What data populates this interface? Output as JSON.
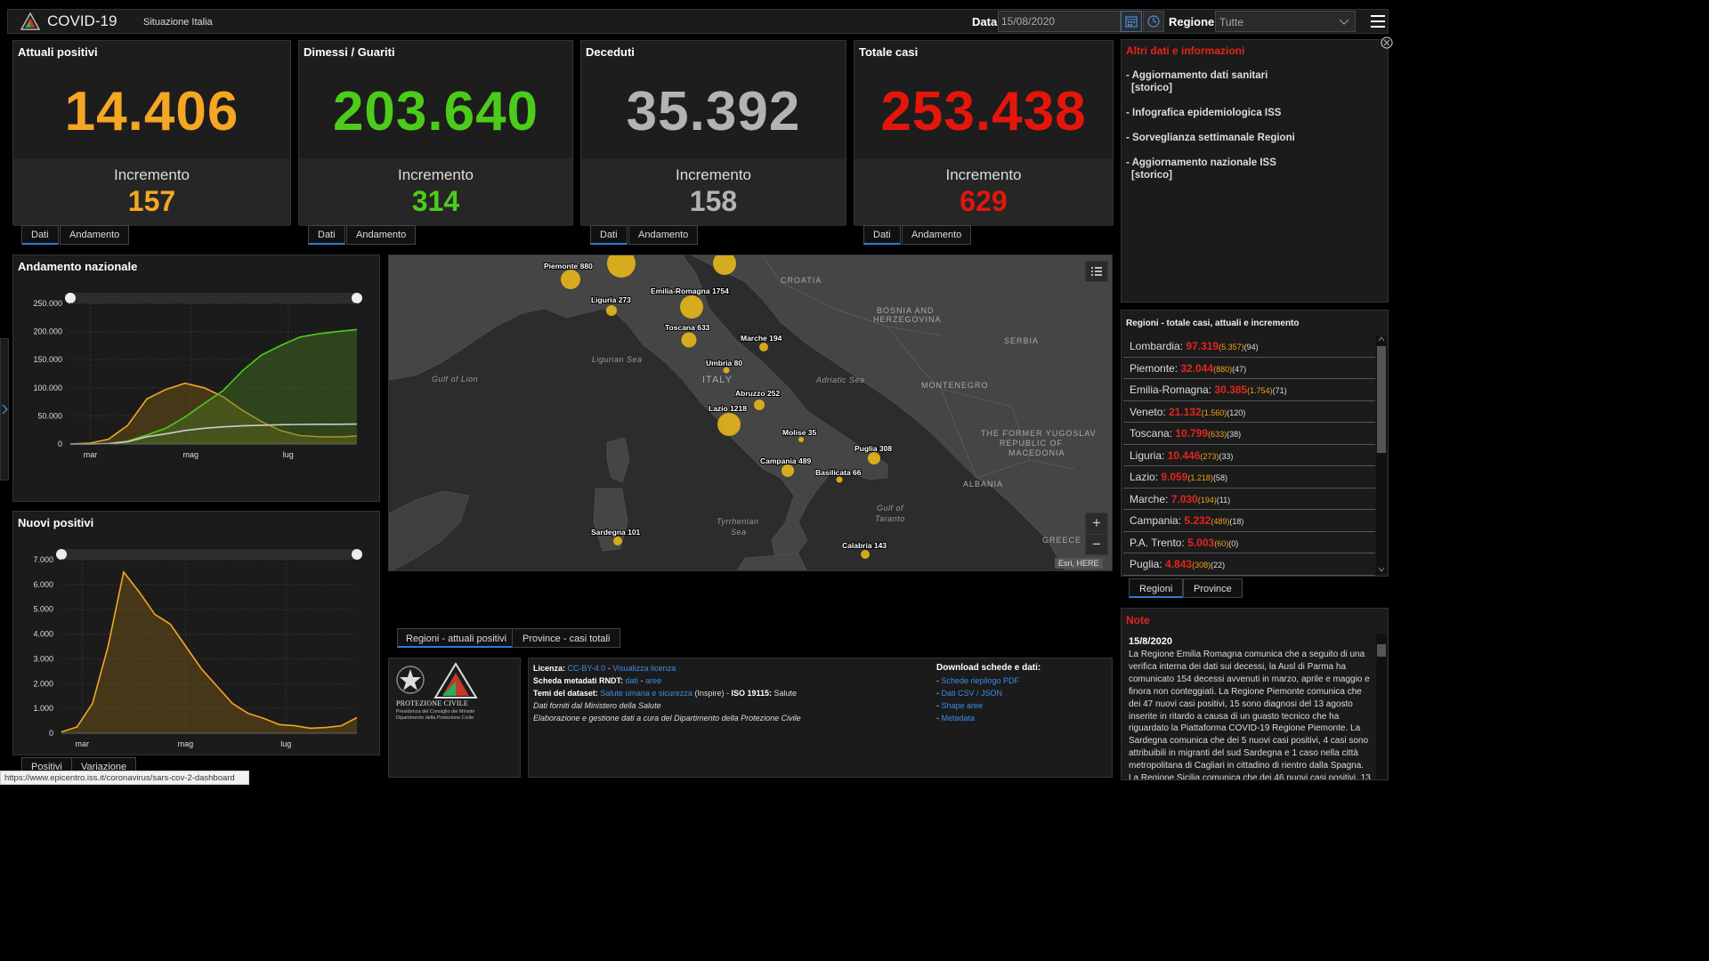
{
  "header": {
    "title": "COVID-19",
    "subtitle": "Situazione Italia",
    "date_label": "Data",
    "date_value": "15/08/2020",
    "region_label": "Regione",
    "region_value": "Tutte"
  },
  "stats": [
    {
      "title": "Attuali positivi",
      "value": "14.406",
      "inc_label": "Incremento",
      "inc": "157",
      "color": "#f5a623"
    },
    {
      "title": "Dimessi / Guariti",
      "value": "203.640",
      "inc_label": "Incremento",
      "inc": "314",
      "color": "#4ccc1a"
    },
    {
      "title": "Deceduti",
      "value": "35.392",
      "inc_label": "Incremento",
      "inc": "158",
      "color": "#b3b3b3"
    },
    {
      "title": "Totale casi",
      "value": "253.438",
      "inc_label": "Incremento",
      "inc": "629",
      "color": "#e4160c"
    }
  ],
  "stat_tabs": {
    "dati": "Dati",
    "andamento": "Andamento"
  },
  "info": {
    "title": "Altri dati e informazioni",
    "items": [
      "- Aggiornamento dati sanitari",
      "[storico]",
      "- Infografica epidemiologica ISS",
      "- Sorveglianza settimanale Regioni",
      "- Aggiornamento nazionale ISS",
      "[storico]"
    ]
  },
  "regions": {
    "title": "Regioni - totale casi, attuali e incremento",
    "rows": [
      {
        "name": "Lombardia:",
        "total": "97.319",
        "active": "(5.357)",
        "inc": "(94)"
      },
      {
        "name": "Piemonte:",
        "total": "32.044",
        "active": "(880)",
        "inc": "(47)"
      },
      {
        "name": "Emilia-Romagna:",
        "total": "30.385",
        "active": "(1.754)",
        "inc": "(71)"
      },
      {
        "name": "Veneto:",
        "total": "21.132",
        "active": "(1.560)",
        "inc": "(120)"
      },
      {
        "name": "Toscana:",
        "total": "10.799",
        "active": "(633)",
        "inc": "(38)"
      },
      {
        "name": "Liguria:",
        "total": "10.446",
        "active": "(273)",
        "inc": "(33)"
      },
      {
        "name": "Lazio:",
        "total": "9.059",
        "active": "(1.218)",
        "inc": "(58)"
      },
      {
        "name": "Marche:",
        "total": "7.030",
        "active": "(194)",
        "inc": "(11)"
      },
      {
        "name": "Campania:",
        "total": "5.232",
        "active": "(489)",
        "inc": "(18)"
      },
      {
        "name": "P.A. Trento:",
        "total": "5.003",
        "active": "(60)",
        "inc": "(0)"
      },
      {
        "name": "Puglia:",
        "total": "4.843",
        "active": "(308)",
        "inc": "(22)"
      }
    ],
    "tab_regioni": "Regioni",
    "tab_province": "Province"
  },
  "note": {
    "title": "Note",
    "date": "15/8/2020",
    "text": "La Regione Emilia Romagna comunica che a seguito di una verifica interna dei dati sui decessi, la Ausl di Parma ha comunicato 154 decessi avvenuti in marzo, aprile e maggio e finora non conteggiati. La Regione Piemonte comunica che dei 47 nuovi casi positivi, 15 sono diagnosi del 13 agosto inserite in ritardo a causa di un guasto tecnico che ha riguardato la Piattaforma COVID-19 Regione Piemonte. La Sardegna comunica che dei 5 nuovi casi positivi, 4 casi sono attribuibili in migranti del sud Sardegna e 1 caso nella città metropolitana di Cagliari in cittadino di rientro dalla Spagna. La Regione Sicilia comunica che dei 46 nuovi casi positivi, 13"
  },
  "andamento": {
    "title": "Andamento nazionale",
    "yticks": [
      "250.000",
      "200.000",
      "150.000",
      "100.000",
      "50.000",
      "0"
    ],
    "xticks": [
      "mar",
      "mag",
      "lug"
    ]
  },
  "nuovi": {
    "title": "Nuovi positivi",
    "yticks": [
      "7.000",
      "6.000",
      "5.000",
      "4.000",
      "3.000",
      "2.000",
      "1.000",
      "0"
    ],
    "xticks": [
      "mar",
      "mag",
      "lug"
    ],
    "tab_positivi": "Positivi",
    "tab_variazione": "Variazione"
  },
  "chart_data": [
    {
      "type": "area",
      "title": "Andamento nazionale",
      "x": [
        "feb-24",
        "mar-01",
        "mar-10",
        "mar-20",
        "apr-01",
        "apr-10",
        "apr-20",
        "mag-01",
        "mag-10",
        "mag-20",
        "giu-01",
        "giu-15",
        "lug-01",
        "lug-15",
        "ago-01",
        "ago-15"
      ],
      "series": [
        {
          "values": [
            200,
            1500,
            8500,
            33000,
            80000,
            97000,
            108000,
            100000,
            84000,
            60000,
            40000,
            24000,
            15000,
            13000,
            12500,
            14400
          ]
        },
        {
          "values": [
            0,
            50,
            700,
            5000,
            16000,
            28000,
            48000,
            72000,
            95000,
            130000,
            158000,
            175000,
            190000,
            196000,
            200000,
            203640
          ]
        },
        {
          "values": [
            10,
            30,
            630,
            4000,
            13000,
            18000,
            24000,
            28000,
            30500,
            32300,
            33400,
            34300,
            34800,
            35100,
            35200,
            35392
          ]
        }
      ],
      "ylim": [
        0,
        250000
      ]
    },
    {
      "type": "area",
      "title": "Nuovi positivi",
      "x": [
        "feb-24",
        "mar-01",
        "mar-08",
        "mar-15",
        "mar-21",
        "mar-28",
        "apr-04",
        "apr-11",
        "apr-18",
        "apr-25",
        "mag-02",
        "mag-09",
        "mag-16",
        "mag-23",
        "giu-01",
        "giu-15",
        "lug-01",
        "lug-15",
        "ago-01",
        "ago-15"
      ],
      "series": [
        {
          "values": [
            50,
            250,
            1200,
            3500,
            6500,
            5700,
            4800,
            4400,
            3500,
            2600,
            1900,
            1200,
            800,
            600,
            350,
            300,
            200,
            230,
            300,
            629
          ]
        }
      ],
      "ylim": [
        0,
        7000
      ]
    }
  ],
  "map": {
    "labels": {
      "gulf_lion": "Gulf of Lion",
      "ligurian": "Ligurian Sea",
      "adriatic": "Adriatic Sea",
      "tyrrhenian1": "Tyrrhenian",
      "tyrrhenian2": "Sea",
      "gulf_taranto1": "Gulf of",
      "gulf_taranto2": "Taranto",
      "italy": "ITALY",
      "croatia": "CROATIA",
      "bosnia1": "BOSNIA AND",
      "bosnia2": "HERZEGOVINA",
      "serbia": "SERBIA",
      "montenegro": "MONTENEGRO",
      "albania": "ALBANIA",
      "macedonia1": "THE FORMER YUGOSLAV",
      "macedonia2": "REPUBLIC OF",
      "macedonia3": "MACEDONIA",
      "greece": "GREECE",
      "attribution": "Esri, HERE"
    },
    "bubbles": [
      {
        "label": "Piemonte 880"
      },
      {
        "label": "Liguria 273"
      },
      {
        "label": "Emilia-Romagna 1754"
      },
      {
        "label": "Toscana 633"
      },
      {
        "label": "Marche 194"
      },
      {
        "label": "Umbria 80"
      },
      {
        "label": "Abruzzo 252"
      },
      {
        "label": "Lazio 1218"
      },
      {
        "label": "Molise 35"
      },
      {
        "label": "Puglia 308"
      },
      {
        "label": "Campania 489"
      },
      {
        "label": "Basilicata 66"
      },
      {
        "label": "Sardegna 101"
      },
      {
        "label": "Calabria 143"
      }
    ],
    "tab_regioni": "Regioni - attuali positivi",
    "tab_province": "Province - casi totali"
  },
  "footer": {
    "logo_text1": "PROTEZIONE CIVILE",
    "logo_text2": "Presidenza del Consiglio dei Ministri",
    "logo_text3": "Dipartimento della Protezione Civile",
    "licenza_label": "Licenza:",
    "licenza_val": "CC-BY-4.0",
    "licenza_link": "Visualizza licenza",
    "scheda_label": "Scheda metadati RNDT:",
    "scheda_dati": "dati",
    "scheda_aree": "aree",
    "temi_label": "Temi del dataset:",
    "temi_val": "Salute umana e sicurezza",
    "temi_inspire": "(Inspire) -",
    "iso_label": "ISO 19115:",
    "iso_val": "Salute",
    "dati_forniti": "Dati forniti dal Ministero della Salute",
    "elaborazione": "Elaborazione e gestione dati a cura del Dipartimento della Protezione Civile",
    "download_title": "Download schede e dati:",
    "downloads": [
      "Schede riepilogo PDF",
      "Dati CSV / JSON",
      "Shape aree",
      "Metadata"
    ]
  },
  "status_url": "https://www.epicentro.iss.it/coronavirus/sars-cov-2-dashboard"
}
